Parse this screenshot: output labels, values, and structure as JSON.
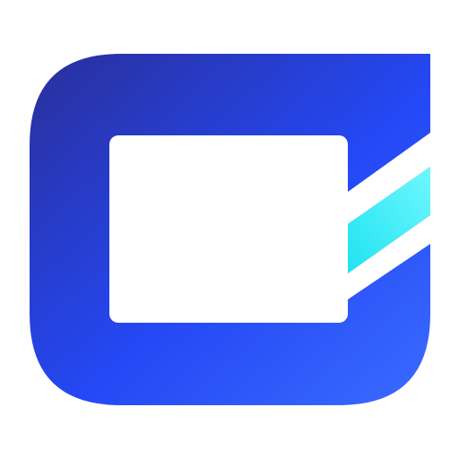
{
  "logo": {
    "icon": "video-camera-icon",
    "colors": {
      "background": "#ffffff",
      "body_gradient_start": "#2a2f9a",
      "body_gradient_mid": "#2448f5",
      "body_gradient_end": "#3a6bff",
      "screen": "#ffffff",
      "beam_start": "#1fe3f0",
      "beam_end": "#6ff7ff",
      "band": "#ffffff"
    }
  }
}
